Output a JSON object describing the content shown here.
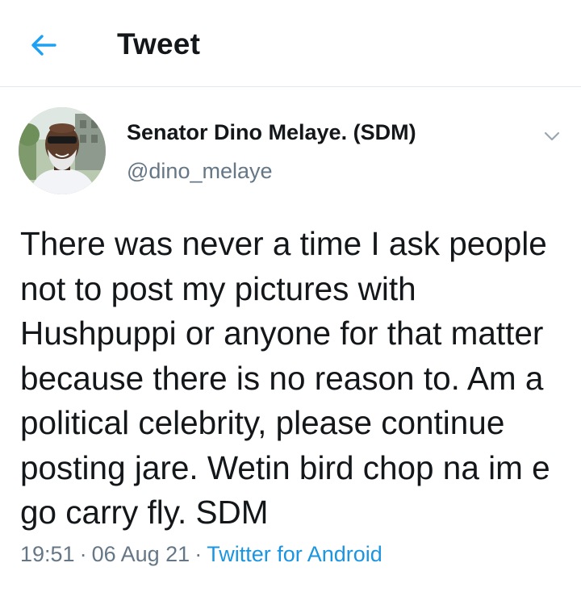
{
  "header": {
    "title": "Tweet",
    "back_icon": "arrow-left-icon",
    "accent_color": "#1da1f2"
  },
  "tweet": {
    "display_name": "Senator Dino Melaye. (SDM)",
    "handle": "@dino_melaye",
    "text": "There was never a time I ask people not to post my pictures with Hushpuppi or anyone for that matter because there is no reason to. Am a political celebrity, please continue posting jare. Wetin bird chop na im e go carry fly. SDM",
    "time": "19:51",
    "date": "06 Aug 21",
    "separator": "·",
    "source": "Twitter for Android",
    "source_color": "#1b95e0",
    "caret_icon": "chevron-down-icon"
  }
}
